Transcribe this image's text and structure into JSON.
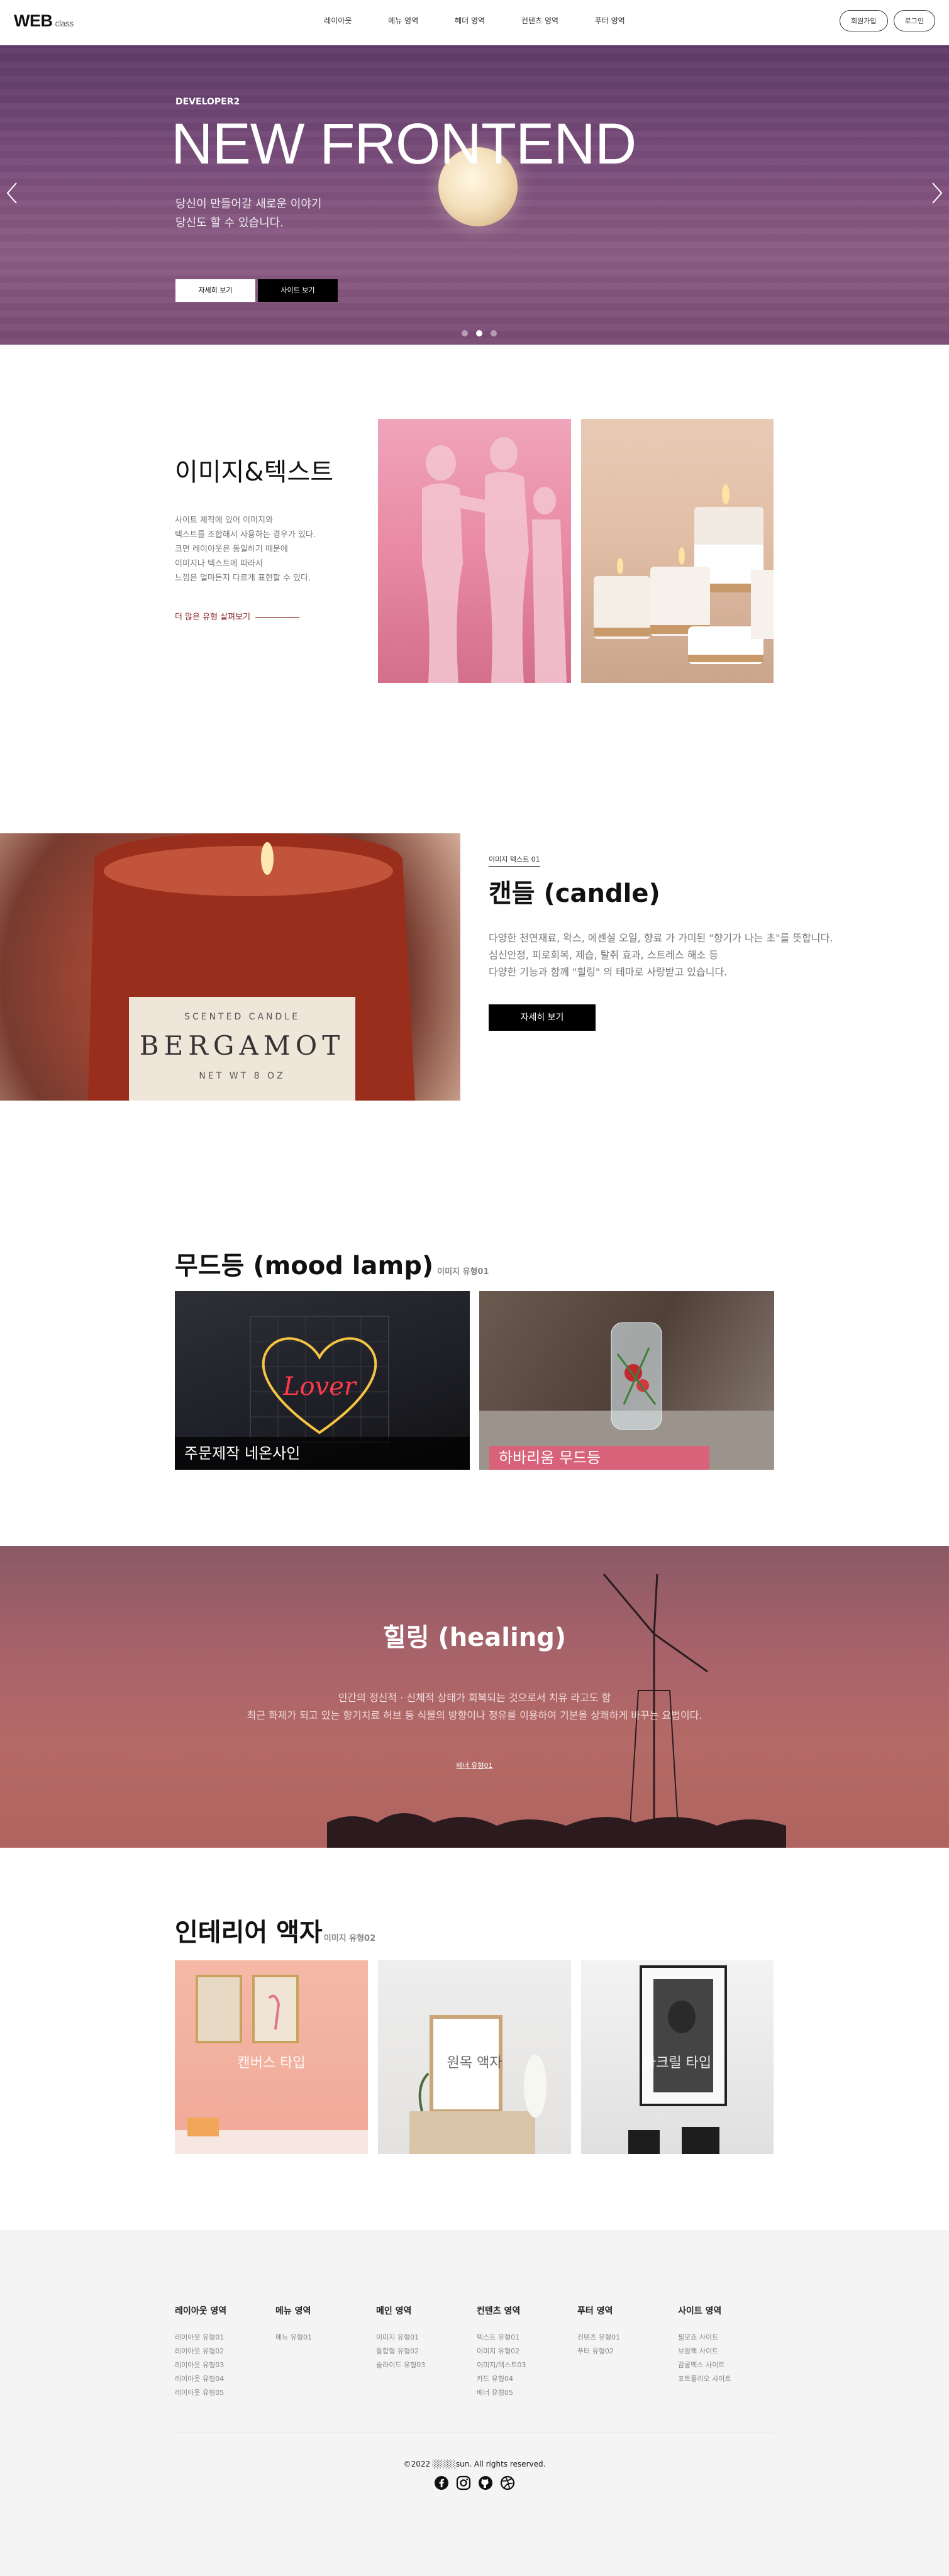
{
  "header": {
    "logo_main": "WEB",
    "logo_sub": "class",
    "nav": [
      "레이아웃",
      "메뉴 영역",
      "헤더 영역",
      "컨텐츠 영역",
      "푸터 영역"
    ],
    "signup": "회원가입",
    "login": "로그인"
  },
  "slider": {
    "eyebrow": "DEVELOPER2",
    "title": "NEW FRONTEND",
    "desc_line1": "당신이 만들어갈 새로운 이야기",
    "desc_line2": "당신도 할 수 있습니다.",
    "btn_detail": "자세히 보기",
    "btn_site": "사이트 보기",
    "prev_icon": "chevron-left-icon",
    "next_icon": "chevron-right-icon",
    "active_dot": 2
  },
  "imgtext": {
    "title": "이미지&텍스트",
    "desc": [
      "사이트 제작에 있어 이미지와",
      "텍스트를 조합해서 사용하는 경우가 있다.",
      "크면 레이아웃은 동일하기 때문에",
      "이미지나 텍스트에 따라서",
      "느낌은 얼마든지 다르게 표현할 수 있다."
    ],
    "more": "더 많은 유형 살펴보기"
  },
  "candle": {
    "eyebrow": "이미지 텍스트 01",
    "title": "캔들 (candle)",
    "desc": [
      "다양한 천연재료, 왁스, 에센셜 오일, 향료 가 가미된 \"향기가 나는 초\"를 뜻합니다.",
      "심신안정, 피로회복, 제습, 탈취 효과, 스트레스 해소 등",
      "다양한 기능과 함께 \"힐링\" 의 테마로 사랑받고 있습니다."
    ],
    "button": "자세히 보기",
    "jar_label_top": "SCENTED CANDLE",
    "jar_label_main": "BERGAMOT",
    "jar_label_bottom": "NET WT 8 OZ"
  },
  "mood": {
    "title": "무드등 (mood lamp)",
    "sub": "이미지 유형01",
    "card1": "주문제작 네온사인",
    "card2": "하바리움 무드등",
    "neon_text": "Lover"
  },
  "healing": {
    "title": "힐링 (healing)",
    "desc_line1": "인간의 정신적 · 신체적 상태가 회복되는 것으로서 치유 라고도 함",
    "desc_line2": "최근 화제가 되고 있는 향기치료 허브 등 식물의 방향이나 정유를 이용하여 기분을 상쾌하게 바꾸는 요법이다.",
    "link": "배너 유형01"
  },
  "interior": {
    "title": "인테리어 액자",
    "sub": "이미지 유형02",
    "cards": [
      "캔버스 타입",
      "원목 액자",
      "아크릴 타입"
    ]
  },
  "footer": {
    "columns": [
      {
        "title": "레이아웃 영역",
        "items": [
          "레이아웃 유형01",
          "레이아웃 유형02",
          "레이아웃 유형03",
          "레이아웃 유형04",
          "레이아웃 유형05"
        ]
      },
      {
        "title": "메뉴 영역",
        "items": [
          "메뉴 유형01"
        ]
      },
      {
        "title": "메인 영역",
        "items": [
          "이미지 유형01",
          "통합형 유형02",
          "슬라이드 유형03"
        ]
      },
      {
        "title": "컨텐츠 영역",
        "items": [
          "텍스트 유형01",
          "이미지 유형02",
          "이미지/텍스트03",
          "카드 유형04",
          "배너 유형05"
        ]
      },
      {
        "title": "푸터 영역",
        "items": [
          "컨텐츠 유형01",
          "푸터 유형02"
        ]
      },
      {
        "title": "사이트 영역",
        "items": [
          "필모죠 사이트",
          "보람팩 사이트",
          "감롱맥스 사이트",
          "포트폴리오 사이트"
        ]
      }
    ],
    "copyright": "©2022 ░░░░sun. All rights reserved.",
    "sns": [
      "facebook-icon",
      "instagram-icon",
      "github-icon",
      "dribbble-icon"
    ]
  },
  "colors": {
    "slider_bg": "#6e4675",
    "accent_pink": "#e05b76",
    "more_link": "#8a2a2a",
    "healing_bg": "#a8626a",
    "footer_bg": "#f4f4f4"
  }
}
